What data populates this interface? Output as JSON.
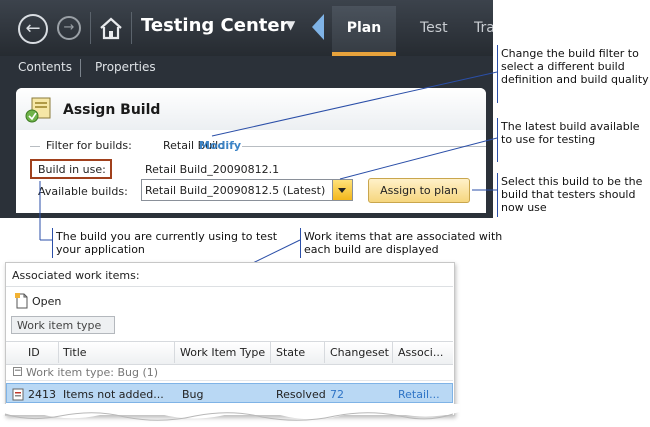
{
  "app": {
    "title": "Testing Center",
    "tabs": [
      {
        "label": "Plan",
        "selected": true
      },
      {
        "label": "Test",
        "selected": false
      },
      {
        "label": "Track",
        "selected": false
      }
    ],
    "subnav": {
      "contents": "Contents",
      "properties": "Properties"
    }
  },
  "assign_build": {
    "title": "Assign Build",
    "filter_label": "Filter for builds:",
    "filter_value": "Retail Build",
    "modify_link": "Modify",
    "build_in_use_label": "Build in use:",
    "build_in_use_value": "Retail Build_20090812.1",
    "available_label": "Available builds:",
    "available_value": "Retail Build_20090812.5 (Latest)",
    "assign_button": "Assign to plan"
  },
  "callouts": {
    "filter": "Change the build filter to select a different build definition and build quality",
    "latest": "The latest build available to use for testing",
    "assign": "Select this build to be the build that testers should now use",
    "in_use": "The build you are currently using to test your application",
    "work_items": "Work items that are associated with each build are displayed"
  },
  "work_items": {
    "title": "Associated work items:",
    "open_button": "Open",
    "group_by": "Work item type",
    "columns": [
      "ID",
      "Title",
      "Work Item Type",
      "State",
      "Changeset",
      "Associ..."
    ],
    "group_row": "Work item type: Bug (1)",
    "rows": [
      {
        "id": "2413",
        "title": "Items not added...",
        "type": "Bug",
        "state": "Resolved",
        "changeset": "72",
        "associated": "Retail..."
      }
    ]
  },
  "colors": {
    "app_frame": "#2b3139",
    "accent_tab": "#e8a33c",
    "link": "#3d84c6",
    "selected_row": "#b9d8f4",
    "callout_line": "#2b4fa8",
    "highlight_box": "#a0401c"
  }
}
